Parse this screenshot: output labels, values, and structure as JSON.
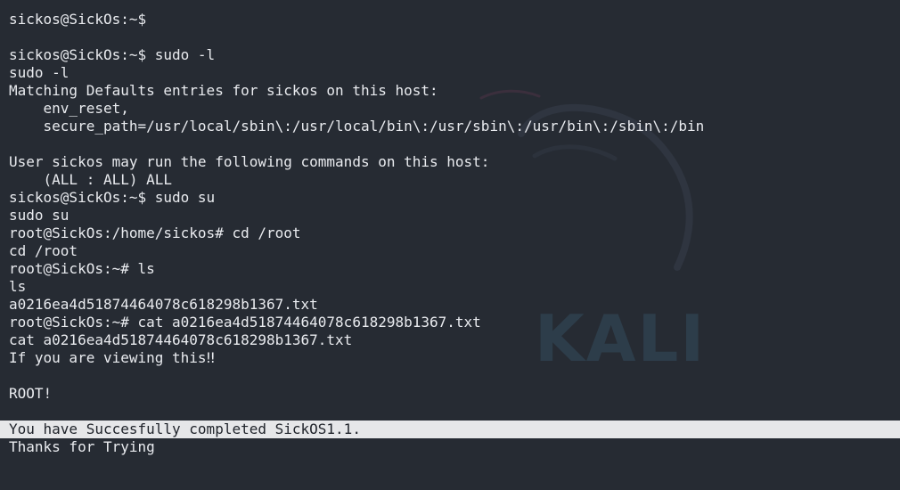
{
  "terminal": {
    "lines": [
      "sickos@SickOs:~$ ",
      "",
      "sickos@SickOs:~$ sudo -l",
      "sudo -l",
      "Matching Defaults entries for sickos on this host:",
      "    env_reset,",
      "    secure_path=/usr/local/sbin\\:/usr/local/bin\\:/usr/sbin\\:/usr/bin\\:/sbin\\:/bin",
      "",
      "User sickos may run the following commands on this host:",
      "    (ALL : ALL) ALL",
      "sickos@SickOs:~$ sudo su",
      "sudo su",
      "root@SickOs:/home/sickos# cd /root",
      "cd /root",
      "root@SickOs:~# ls",
      "ls",
      "a0216ea4d51874464078c618298b1367.txt",
      "root@SickOs:~# cat a0216ea4d51874464078c618298b1367.txt",
      "cat a0216ea4d51874464078c618298b1367.txt",
      "If you are viewing this‼",
      "",
      "ROOT!",
      "",
      "You have Succesfully completed SickOS1.1.",
      "Thanks for Trying"
    ],
    "selected_line_index": 23
  },
  "desktop": {
    "watermark_text": "KALI",
    "colors": {
      "background": "#262b33",
      "text": "#e9ebef",
      "selection_bg": "#e6e7e9",
      "selection_text": "#1f232a"
    }
  }
}
